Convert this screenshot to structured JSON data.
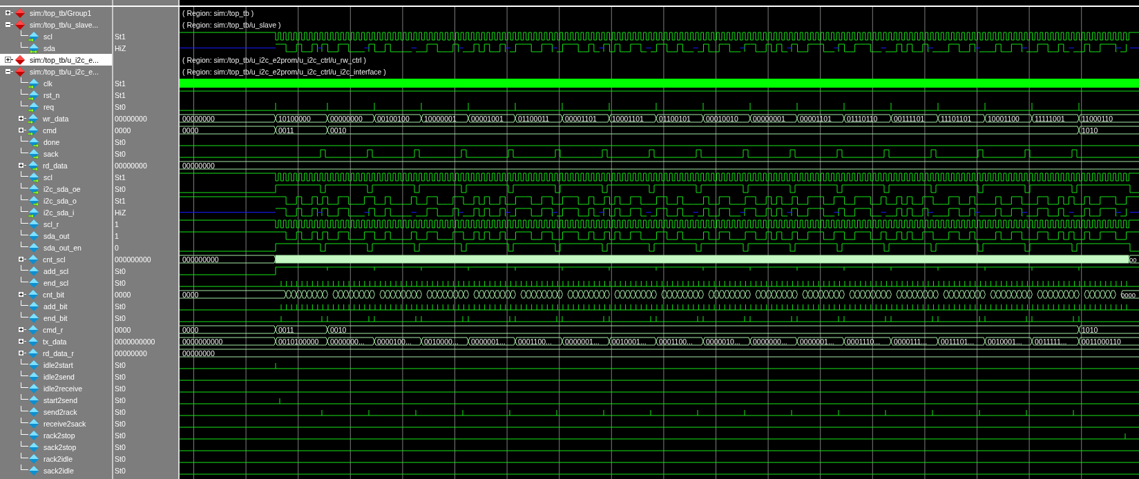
{
  "wave_window": {
    "groups": [
      {
        "label": "sim:/top_tb/Group1",
        "expanded": false,
        "selected": false,
        "region": "( Region: sim:/top_tb )"
      },
      {
        "label": "sim:/top_tb/u_slave...",
        "expanded": true,
        "selected": false,
        "region": "( Region: sim:/top_tb/u_slave )",
        "children": [
          {
            "label": "scl",
            "value": "St1",
            "input": true,
            "output": false,
            "kind": "clock",
            "selected": false
          },
          {
            "label": "sda",
            "value": "HiZ",
            "input": true,
            "output": true,
            "kind": "serial-hiz",
            "selected": false
          }
        ]
      },
      {
        "label": "sim:/top_tb/u_i2c_e...",
        "expanded": false,
        "selected": true,
        "region": "( Region: sim:/top_tb/u_i2c_e2prom/u_i2c_ctrl/u_rw_ctrl )"
      },
      {
        "label": "sim:/top_tb/u_i2c_e...",
        "expanded": true,
        "selected": false,
        "region": "( Region: sim:/top_tb/u_i2c_e2prom/u_i2c_ctrl/u_i2c_interface )",
        "children": [
          {
            "label": "clk",
            "value": "St1",
            "input": true,
            "output": false,
            "kind": "fast",
            "selected": false
          },
          {
            "label": "rst_n",
            "value": "St1",
            "input": true,
            "output": false,
            "kind": "high",
            "selected": false
          },
          {
            "label": "req",
            "value": "St0",
            "input": true,
            "output": false,
            "kind": "event-pulse",
            "selected": false
          },
          {
            "label": "wr_data",
            "value": "00000000",
            "input": true,
            "output": false,
            "kind": "bus",
            "expanded": false,
            "selected": false,
            "segments": [
              "00000000",
              "10100000",
              "00000000",
              "00100100",
              "10000001",
              "00001001",
              "01100011",
              "00001101",
              "10001101",
              "01100101",
              "00010010",
              "00000001",
              "00001101",
              "01110110",
              "00111101",
              "11101101",
              "10001100",
              "11111001",
              "11000110"
            ]
          },
          {
            "label": "cmd",
            "value": "0000",
            "input": true,
            "output": false,
            "kind": "bus-cmd",
            "expanded": false,
            "selected": false,
            "segments": [
              "0000",
              "0011",
              "0010",
              "1010"
            ]
          },
          {
            "label": "done",
            "value": "St0",
            "input": false,
            "output": true,
            "kind": "low",
            "selected": false
          },
          {
            "label": "sack",
            "value": "St0",
            "input": false,
            "output": true,
            "kind": "ack",
            "selected": false
          },
          {
            "label": "rd_data",
            "value": "00000000",
            "input": false,
            "output": true,
            "kind": "bus",
            "expanded": false,
            "selected": false,
            "segments": [
              "00000000"
            ]
          },
          {
            "label": "scl",
            "value": "St1",
            "input": false,
            "output": true,
            "kind": "clock",
            "selected": false
          },
          {
            "label": "i2c_sda_oe",
            "value": "St0",
            "input": false,
            "output": true,
            "kind": "ack-dip",
            "selected": false
          },
          {
            "label": "i2c_sda_o",
            "value": "St1",
            "input": false,
            "output": true,
            "kind": "serial",
            "selected": false
          },
          {
            "label": "i2c_sda_i",
            "value": "HiZ",
            "input": true,
            "output": false,
            "kind": "serial-hiz",
            "selected": false
          },
          {
            "label": "scl_r",
            "value": "1",
            "input": false,
            "output": false,
            "kind": "clock",
            "selected": false
          },
          {
            "label": "sda_out",
            "value": "1",
            "input": false,
            "output": false,
            "kind": "serial",
            "selected": false
          },
          {
            "label": "sda_out_en",
            "value": "0",
            "input": false,
            "output": false,
            "kind": "ack-dip",
            "selected": false
          },
          {
            "label": "cnt_scl",
            "value": "000000000",
            "input": false,
            "output": false,
            "kind": "bus-dense",
            "expanded": false,
            "selected": false,
            "segments": [
              "000000000",
              "00"
            ]
          },
          {
            "label": "add_scl",
            "value": "St0",
            "input": false,
            "output": false,
            "kind": "step-high",
            "selected": false
          },
          {
            "label": "end_scl",
            "value": "St0",
            "input": false,
            "output": false,
            "kind": "ticks",
            "selected": false
          },
          {
            "label": "cnt_bit",
            "value": "0000",
            "input": false,
            "output": false,
            "kind": "bus-count",
            "expanded": false,
            "selected": false,
            "segments": [
              "0000",
              "0000"
            ]
          },
          {
            "label": "add_bit",
            "value": "St0",
            "input": false,
            "output": false,
            "kind": "ticks",
            "selected": false
          },
          {
            "label": "end_bit",
            "value": "St0",
            "input": false,
            "output": false,
            "kind": "byte-end",
            "selected": false
          },
          {
            "label": "cmd_r",
            "value": "0000",
            "input": false,
            "output": false,
            "kind": "bus-cmd",
            "expanded": false,
            "selected": false,
            "segments": [
              "0000",
              "0011",
              "0010",
              "1010"
            ]
          },
          {
            "label": "tx_data",
            "value": "0000000000",
            "input": false,
            "output": false,
            "kind": "bus",
            "expanded": false,
            "selected": false,
            "segments": [
              "0000000000",
              "0010100000",
              "0000000...",
              "0000100...",
              "0010000...",
              "0000001...",
              "0001100...",
              "0000001...",
              "0010001...",
              "0001100...",
              "0000010...",
              "0000000...",
              "0000001...",
              "0001110...",
              "0000111...",
              "0011101...",
              "0010001...",
              "0011111...",
              "0011000110"
            ]
          },
          {
            "label": "rd_data_r",
            "value": "00000000",
            "input": false,
            "output": false,
            "kind": "bus",
            "expanded": false,
            "selected": false,
            "segments": [
              "00000000"
            ]
          },
          {
            "label": "idle2start",
            "value": "St0",
            "input": false,
            "output": false,
            "kind": "pulse-at-start",
            "selected": false
          },
          {
            "label": "idle2send",
            "value": "St0",
            "input": false,
            "output": false,
            "kind": "low",
            "selected": false
          },
          {
            "label": "idle2receive",
            "value": "St0",
            "input": false,
            "output": false,
            "kind": "low",
            "selected": false
          },
          {
            "label": "start2send",
            "value": "St0",
            "input": false,
            "output": false,
            "kind": "pulse-after-start",
            "selected": false
          },
          {
            "label": "send2rack",
            "value": "St0",
            "input": false,
            "output": false,
            "kind": "ack-pulse",
            "selected": false
          },
          {
            "label": "receive2sack",
            "value": "St0",
            "input": false,
            "output": false,
            "kind": "low",
            "selected": false
          },
          {
            "label": "rack2stop",
            "value": "St0",
            "input": false,
            "output": false,
            "kind": "end-pulse",
            "selected": false
          },
          {
            "label": "sack2stop",
            "value": "St0",
            "input": false,
            "output": false,
            "kind": "low",
            "selected": false
          },
          {
            "label": "rack2idle",
            "value": "St0",
            "input": false,
            "output": false,
            "kind": "low",
            "selected": false
          },
          {
            "label": "sack2idle",
            "value": "St0",
            "input": false,
            "output": false,
            "kind": "low",
            "selected": false
          }
        ]
      }
    ]
  }
}
